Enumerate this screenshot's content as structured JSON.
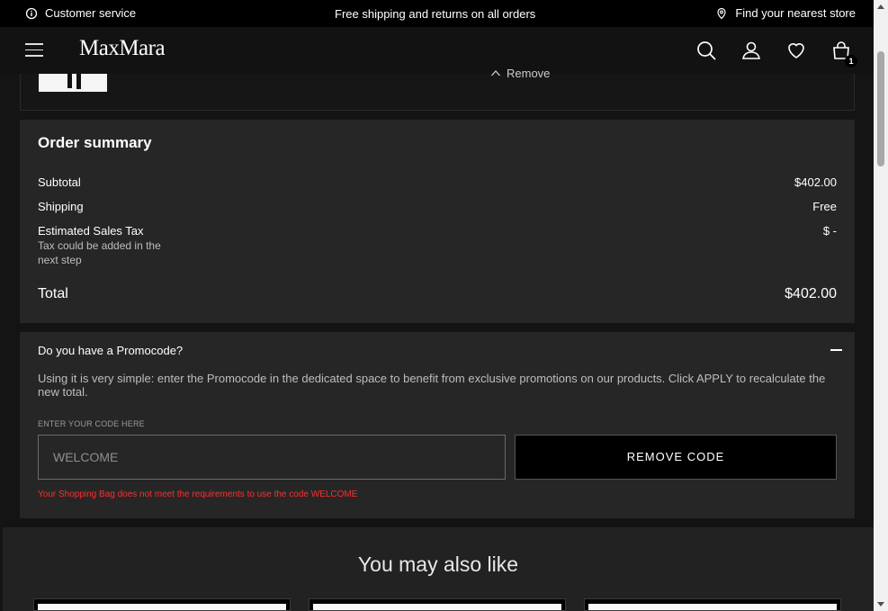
{
  "topbar": {
    "customer_service": "Customer service",
    "shipping_message": "Free shipping and returns on all orders",
    "find_store": "Find your nearest store"
  },
  "header": {
    "logo": "MaxMara",
    "cart_count": "1"
  },
  "product": {
    "remove_label": "Remove"
  },
  "summary": {
    "title": "Order summary",
    "subtotal_label": "Subtotal",
    "subtotal_value": "$402.00",
    "shipping_label": "Shipping",
    "shipping_value": "Free",
    "tax_label": "Estimated Sales Tax",
    "tax_note": "Tax could be added in the next step",
    "tax_value": "$ -",
    "total_label": "Total",
    "total_value": "$402.00"
  },
  "promo": {
    "title": "Do you have a Promocode?",
    "description": "Using it is very simple: enter the Promocode in the dedicated space to benefit from exclusive promotions on our products. Click APPLY to recalculate the new total.",
    "field_label": "ENTER YOUR CODE HERE",
    "field_value": "WELCOME",
    "button_label": "REMOVE CODE",
    "error_message": "Your Shopping Bag does not meet the requirements to use the code WELCOME",
    "error_color": "#ff2d2d"
  },
  "recommendations": {
    "title": "You may also like"
  },
  "icons": [
    "info-icon",
    "location-pin-icon",
    "menu-icon",
    "search-icon",
    "account-icon",
    "wishlist-heart-icon",
    "shopping-bag-icon",
    "chevron-up-icon",
    "minus-icon"
  ]
}
